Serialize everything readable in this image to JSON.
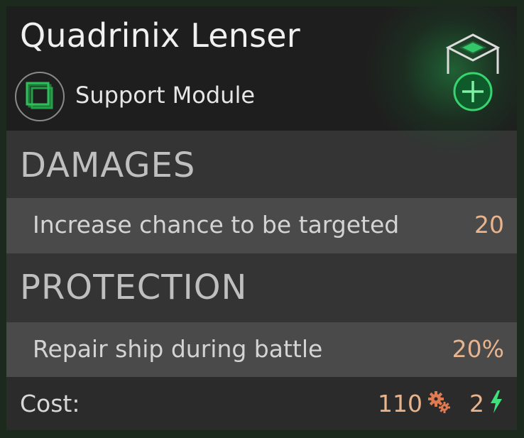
{
  "module": {
    "title": "Quadrinix Lenser",
    "type_label": "Support Module",
    "type_icon": "support-module-icon",
    "action_icon": "add-module-icon",
    "accent_color": "#2ecc71"
  },
  "sections": [
    {
      "heading": "DAMAGES",
      "stats": [
        {
          "label": "Increase chance to be targeted",
          "value": "20"
        }
      ]
    },
    {
      "heading": "PROTECTION",
      "stats": [
        {
          "label": "Repair ship during battle",
          "value": "20%"
        }
      ]
    }
  ],
  "cost": {
    "label": "Cost:",
    "resources": "110",
    "resources_icon": "gears-icon",
    "energy": "2",
    "energy_icon": "lightning-icon",
    "value_color": "#e9b48c"
  }
}
